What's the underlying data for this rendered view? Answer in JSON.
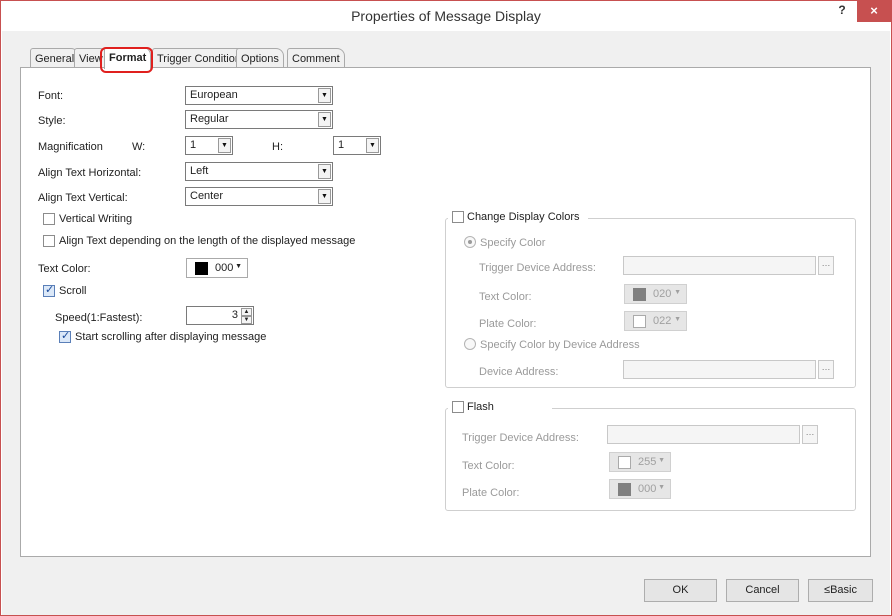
{
  "window": {
    "title": "Properties of Message Display",
    "help": "?",
    "close": "×"
  },
  "tabs": [
    {
      "label": "General"
    },
    {
      "label": "View"
    },
    {
      "label": "Format"
    },
    {
      "label": "Trigger Condition"
    },
    {
      "label": "Options"
    },
    {
      "label": "Comment"
    }
  ],
  "format": {
    "font_label": "Font:",
    "font_value": "European",
    "style_label": "Style:",
    "style_value": "Regular",
    "magnification_label": "Magnification",
    "w_label": "W:",
    "w_value": "1",
    "h_label": "H:",
    "h_value": "1",
    "align_h_label": "Align Text Horizontal:",
    "align_h_value": "Left",
    "align_v_label": "Align Text Vertical:",
    "align_v_value": "Center",
    "vertical_writing": "Vertical Writing",
    "align_by_length": "Align Text depending on the length of the displayed message",
    "text_color_label": "Text Color:",
    "text_color_code": "000",
    "text_color_hex": "#000000",
    "scroll": "Scroll",
    "speed_label": "Speed(1:Fastest):",
    "speed_value": "3",
    "start_scrolling": "Start scrolling after displaying message"
  },
  "change_colors": {
    "title": "Change Display Colors",
    "specify_color": "Specify Color",
    "trigger_label": "Trigger Device Address:",
    "text_color_label": "Text Color:",
    "text_color_code": "020",
    "text_color_hex": "#808080",
    "plate_color_label": "Plate Color:",
    "plate_color_code": "022",
    "plate_color_hex": "#ffffff",
    "by_device": "Specify Color by Device Address",
    "device_label": "Device Address:"
  },
  "flash": {
    "title": "Flash",
    "trigger_label": "Trigger Device Address:",
    "text_color_label": "Text Color:",
    "text_color_code": "255",
    "text_color_hex": "#ffffff",
    "plate_color_label": "Plate Color:",
    "plate_color_code": "000",
    "plate_color_hex": "#808080"
  },
  "buttons": {
    "ok": "OK",
    "cancel": "Cancel",
    "basic": "≤Basic"
  },
  "colors": {
    "accent_red": "#e0201e",
    "close_red": "#c75050"
  }
}
